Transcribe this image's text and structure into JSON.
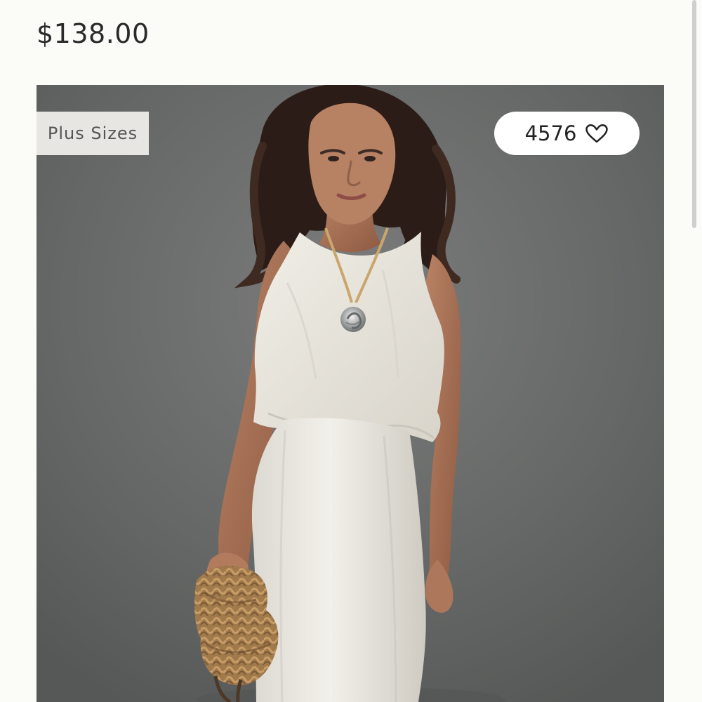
{
  "product": {
    "price": "$138.00",
    "image_alt": "Model wearing white sleeveless top and white maxi skirt holding a woven straw hat",
    "tag_label": "Plus Sizes",
    "likes_count": "4576",
    "like_icon": "heart-icon"
  },
  "colors": {
    "background": "#fbfbf8",
    "image_background": "#686969",
    "tag_background": "#e8e6e3",
    "pill_background": "#ffffff",
    "text": "#2a2a2a"
  }
}
